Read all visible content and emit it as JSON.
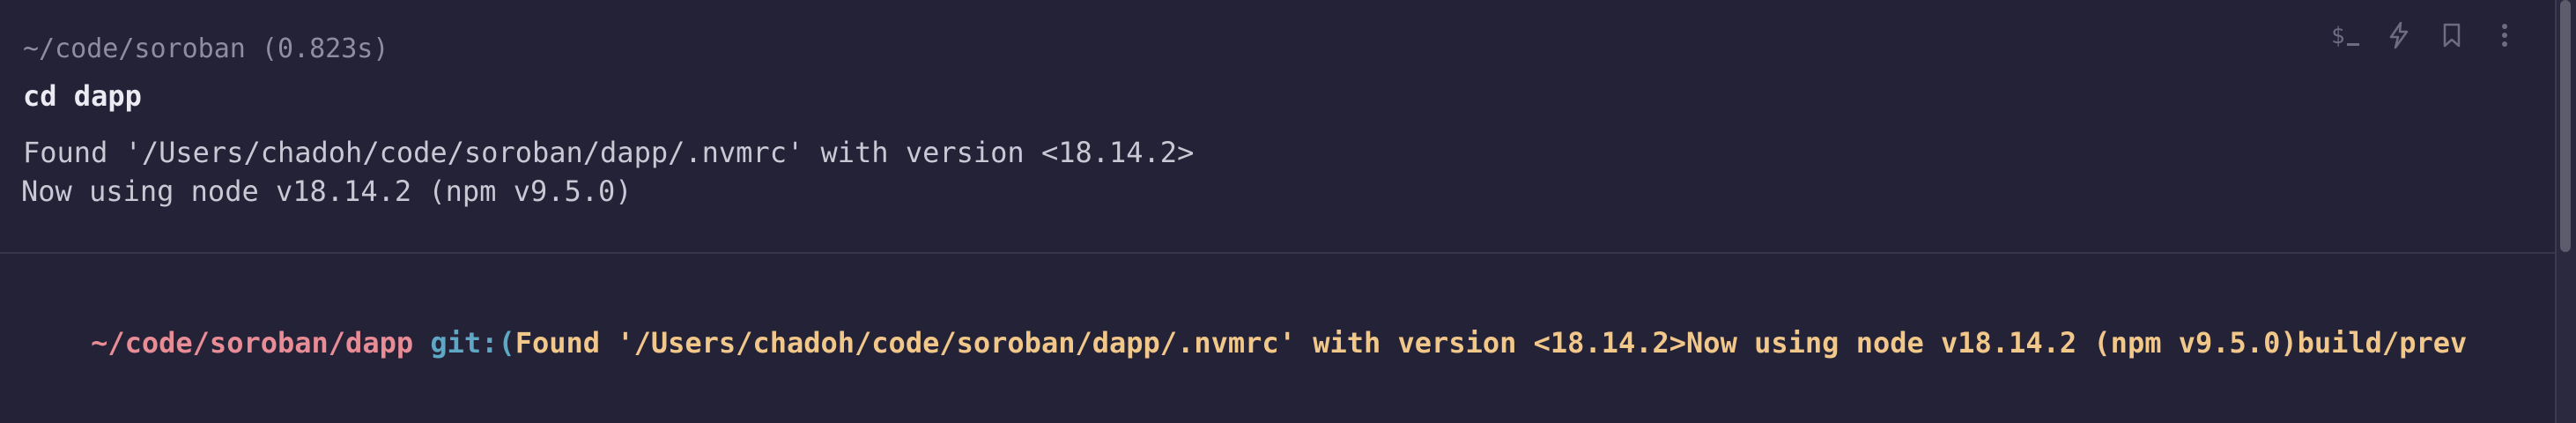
{
  "block": {
    "directory": "~/code/soroban (0.823s)",
    "command": "cd dapp",
    "output": [
      "Found '/Users/chadoh/code/soroban/dapp/.nvmrc' with version <18.14.2>",
      "Now using node v18.14.2 (npm v9.5.0)"
    ],
    "toolbar": {
      "icons": [
        "terminal-dollar-icon",
        "lightning-icon",
        "bookmark-icon",
        "more-vertical-icon"
      ]
    }
  },
  "prompt": {
    "directory": "~/code/soroban/dapp",
    "git_label": "git:(",
    "branch_text": "Found '/Users/chadoh/code/soroban/dapp/.nvmrc' with version <18.14.2>Now using node v18.14.2 (npm v9.5.0)build/prev"
  },
  "colors": {
    "background": "#232237",
    "prompt_directory": "#e88c96",
    "git_label": "#5fa8c5",
    "branch": "#f2c78a",
    "command": "#ecebf3",
    "output": "#c9c8d4",
    "muted": "#8f8ea0"
  }
}
